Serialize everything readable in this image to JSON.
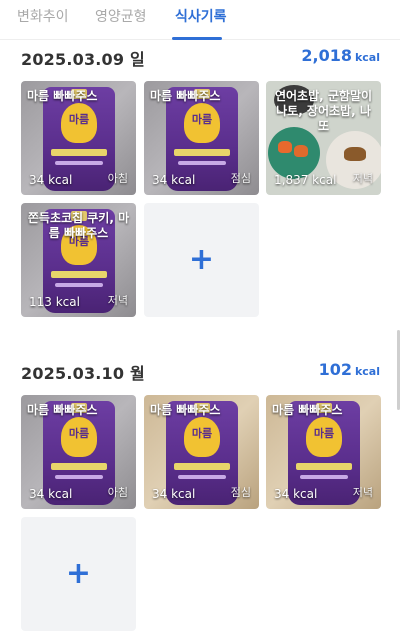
{
  "tabs": [
    {
      "label": "변화추이",
      "active": false
    },
    {
      "label": "영양균형",
      "active": false
    },
    {
      "label": "식사기록",
      "active": true
    }
  ],
  "colors": {
    "accent": "#2f6fd6",
    "inactive_tab": "#a9a9a9",
    "add_tile_bg": "#f2f3f5"
  },
  "days": [
    {
      "date": "2025.03.09 일",
      "total_kcal": "2,018",
      "unit": "kcal",
      "meals": [
        {
          "title": "마름 빠빠주스",
          "kcal": "34 kcal",
          "meal": "아침",
          "image": "purple-pouch"
        },
        {
          "title": "마름 빠빠주스",
          "kcal": "34 kcal",
          "meal": "점심",
          "image": "purple-pouch"
        },
        {
          "title": "연어초밥, 군함말이 나토, 장어초밥, 나또",
          "kcal": "1,837 kcal",
          "meal": "저녁",
          "image": "sushi-plates"
        },
        {
          "title": "쫀득초코칩 쿠키, 마름 빠빠주스",
          "kcal": "113 kcal",
          "meal": "저녁",
          "image": "purple-pouch"
        }
      ],
      "add_icon": "plus-icon"
    },
    {
      "date": "2025.03.10 월",
      "total_kcal": "102",
      "unit": "kcal",
      "meals": [
        {
          "title": "마름 빠빠주스",
          "kcal": "34 kcal",
          "meal": "아침",
          "image": "purple-pouch"
        },
        {
          "title": "마름 빠빠주스",
          "kcal": "34 kcal",
          "meal": "점심",
          "image": "purple-pouch"
        },
        {
          "title": "마름 빠빠주스",
          "kcal": "34 kcal",
          "meal": "저녁",
          "image": "purple-pouch"
        }
      ],
      "add_icon": "plus-icon"
    }
  ],
  "pouch_label": "마름",
  "plus_glyph": "+"
}
